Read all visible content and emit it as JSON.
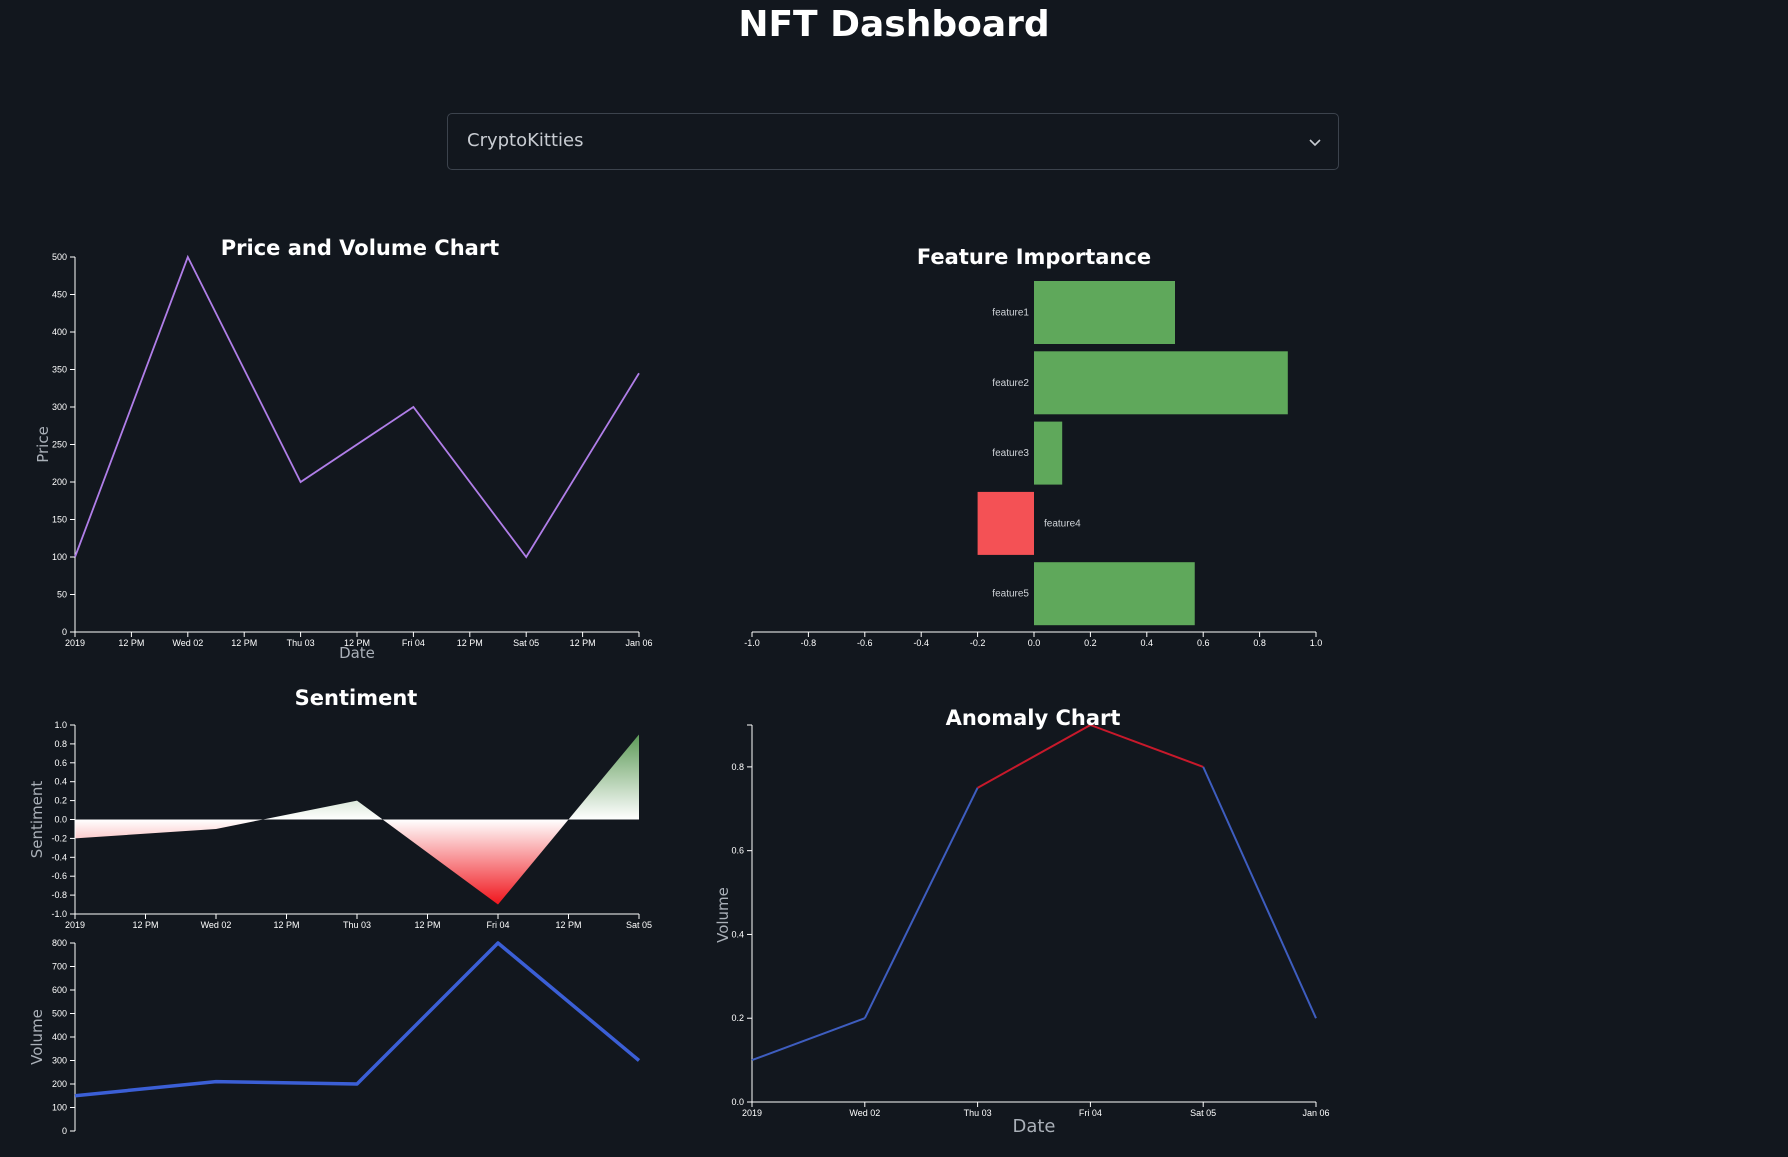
{
  "page": {
    "title": "NFT Dashboard"
  },
  "selector": {
    "value": "CryptoKitties",
    "icon": "chevron-down-icon"
  },
  "colors": {
    "background": "#12171e",
    "price_line": "#b07ee8",
    "positive_bar": "#5fa85b",
    "negative_bar": "#f45155",
    "volume_line": "#3b5fd6",
    "anomaly_normal": "#3e5dbf",
    "anomaly_flag": "#c8192b",
    "sentiment_positive": "#4b8f45",
    "sentiment_negative": "#f0151c"
  },
  "chart_data": [
    {
      "id": "price",
      "type": "line",
      "title": "Price and Volume Chart",
      "xlabel": "Date",
      "ylabel": "Price",
      "x": [
        "2019-01-01T00:00",
        "2019-01-02T00:00",
        "2019-01-03T00:00",
        "2019-01-04T00:00",
        "2019-01-05T00:00",
        "2019-01-06T00:00"
      ],
      "values": [
        100,
        500,
        200,
        300,
        100,
        345
      ],
      "xticks": [
        "2019",
        "12 PM",
        "Wed 02",
        "12 PM",
        "Thu 03",
        "12 PM",
        "Fri 04",
        "12 PM",
        "Sat 05",
        "12 PM",
        "Jan 06"
      ],
      "yticks": [
        0,
        50,
        100,
        150,
        200,
        250,
        300,
        350,
        400,
        450,
        500
      ],
      "ylim": [
        0,
        500
      ],
      "grid": false
    },
    {
      "id": "importance",
      "type": "bar",
      "orientation": "horizontal",
      "title": "Feature Importance",
      "categories": [
        "feature1",
        "feature2",
        "feature3",
        "feature4",
        "feature5"
      ],
      "values": [
        0.5,
        0.9,
        0.1,
        -0.2,
        0.57
      ],
      "xticks": [
        "-1.0",
        "-0.8",
        "-0.6",
        "-0.4",
        "-0.2",
        "0.0",
        "0.2",
        "0.4",
        "0.6",
        "0.8",
        "1.0"
      ],
      "xlim": [
        -1,
        1
      ],
      "grid": false
    },
    {
      "id": "sentiment",
      "type": "area",
      "title": "Sentiment",
      "ylabel": "Sentiment",
      "x": [
        "2019-01-01T00:00",
        "2019-01-02T00:00",
        "2019-01-03T00:00",
        "2019-01-04T00:00",
        "2019-01-05T00:00"
      ],
      "values": [
        -0.2,
        -0.1,
        0.2,
        -0.9,
        0.9
      ],
      "xticks": [
        "2019",
        "12 PM",
        "Wed 02",
        "12 PM",
        "Thu 03",
        "12 PM",
        "Fri 04",
        "12 PM",
        "Sat 05"
      ],
      "yticks": [
        "1.0",
        "0.8",
        "0.6",
        "0.4",
        "0.2",
        "0.0",
        "-0.2",
        "-0.4",
        "-0.6",
        "-0.8",
        "-1.0"
      ],
      "ylim": [
        -1,
        1
      ],
      "grid": false
    },
    {
      "id": "volume",
      "type": "line",
      "ylabel": "Volume",
      "x": [
        "2019-01-01T00:00",
        "2019-01-02T00:00",
        "2019-01-03T00:00",
        "2019-01-04T00:00",
        "2019-01-05T00:00"
      ],
      "values": [
        150,
        210,
        200,
        800,
        300
      ],
      "yticks": [
        0,
        100,
        200,
        300,
        400,
        500,
        600,
        700,
        800
      ],
      "ylim": [
        0,
        800
      ],
      "grid": false
    },
    {
      "id": "anomaly",
      "type": "line",
      "title": "Anomaly Chart",
      "xlabel": "Date",
      "ylabel": "Volume",
      "x": [
        "2019-01-01",
        "2019-01-02",
        "2019-01-03",
        "2019-01-04",
        "2019-01-05",
        "2019-01-06"
      ],
      "values": [
        0.1,
        0.2,
        0.75,
        0.9,
        0.8,
        0.2
      ],
      "anomaly": [
        false,
        false,
        true,
        true,
        true,
        false
      ],
      "xticks": [
        "2019",
        "Wed 02",
        "Thu 03",
        "Fri 04",
        "Sat 05",
        "Jan 06"
      ],
      "yticks": [
        "0.0",
        "0.2",
        "0.4",
        "0.6",
        "0.8"
      ],
      "ylim": [
        0,
        0.9
      ],
      "grid": false
    }
  ]
}
